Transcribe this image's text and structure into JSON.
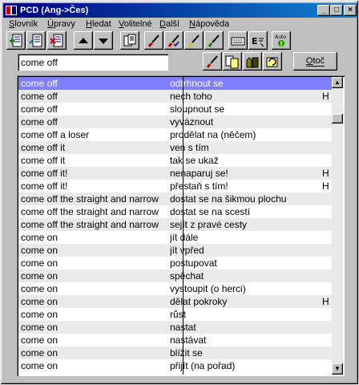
{
  "window": {
    "title": "PCD (Ang->Čes)",
    "btn_min": "_",
    "btn_max": "□",
    "btn_close": "×"
  },
  "menu": {
    "items": [
      {
        "m": "S",
        "rest": "lovník"
      },
      {
        "m": "Ú",
        "rest": "pravy"
      },
      {
        "m": "H",
        "rest": "ledat"
      },
      {
        "m": "V",
        "rest": "olitelné"
      },
      {
        "m": "D",
        "rest": "alší"
      },
      {
        "m": "N",
        "rest": "ápověda"
      }
    ]
  },
  "toolbar": {
    "icons": [
      "add-entry-icon",
      "edit-entry-icon",
      "delete-entry-icon",
      "arrow-up-icon",
      "arrow-down-icon",
      "dictionary-icon",
      "brush-red-icon",
      "brush-check-icon",
      "brush-yellow-icon",
      "brush-green-icon",
      "keyboard-icon",
      "language-switch-icon",
      "auto-icon"
    ],
    "auto_label": "Auto"
  },
  "search": {
    "value": "come off"
  },
  "translate_button": {
    "prefix": "",
    "m": "O",
    "rest": "toč"
  },
  "colors": {
    "selected": "#8080ff",
    "titlebar": "#000080"
  },
  "rows": [
    {
      "en": "come off",
      "cz": "odtrhnout se",
      "flag": "",
      "selected": true
    },
    {
      "en": "come off",
      "cz": "nech toho",
      "flag": "H"
    },
    {
      "en": "come off",
      "cz": "sloupnout se",
      "flag": ""
    },
    {
      "en": "come off",
      "cz": "vyváznout",
      "flag": ""
    },
    {
      "en": "come off a loser",
      "cz": "prodělat na (něčem)",
      "flag": ""
    },
    {
      "en": "come off it",
      "cz": "ven s tím",
      "flag": ""
    },
    {
      "en": "come off it",
      "cz": "tak se ukaž",
      "flag": ""
    },
    {
      "en": "come off it!",
      "cz": "nenaparuj se!",
      "flag": "H"
    },
    {
      "en": "come off it!",
      "cz": "přestaň s tím!",
      "flag": "H"
    },
    {
      "en": "come off the straight and narrow",
      "cz": "dostat se na šikmou plochu",
      "flag": ""
    },
    {
      "en": "come off the straight and narrow",
      "cz": "dostat se na scestí",
      "flag": ""
    },
    {
      "en": "come off the straight and narrow",
      "cz": "sejít z pravé cesty",
      "flag": ""
    },
    {
      "en": "come on",
      "cz": "jít dále",
      "flag": ""
    },
    {
      "en": "come on",
      "cz": "jít vpřed",
      "flag": ""
    },
    {
      "en": "come on",
      "cz": "postupovat",
      "flag": ""
    },
    {
      "en": "come on",
      "cz": "spěchat",
      "flag": ""
    },
    {
      "en": "come on",
      "cz": "vystoupit (o herci)",
      "flag": ""
    },
    {
      "en": "come on",
      "cz": "dělat pokroky",
      "flag": "H"
    },
    {
      "en": "come on",
      "cz": "růst",
      "flag": ""
    },
    {
      "en": "come on",
      "cz": "nastat",
      "flag": ""
    },
    {
      "en": "come on",
      "cz": "nastávat",
      "flag": ""
    },
    {
      "en": "come on",
      "cz": "blížit se",
      "flag": ""
    },
    {
      "en": "come on",
      "cz": "přijít (na pořad)",
      "flag": ""
    }
  ]
}
